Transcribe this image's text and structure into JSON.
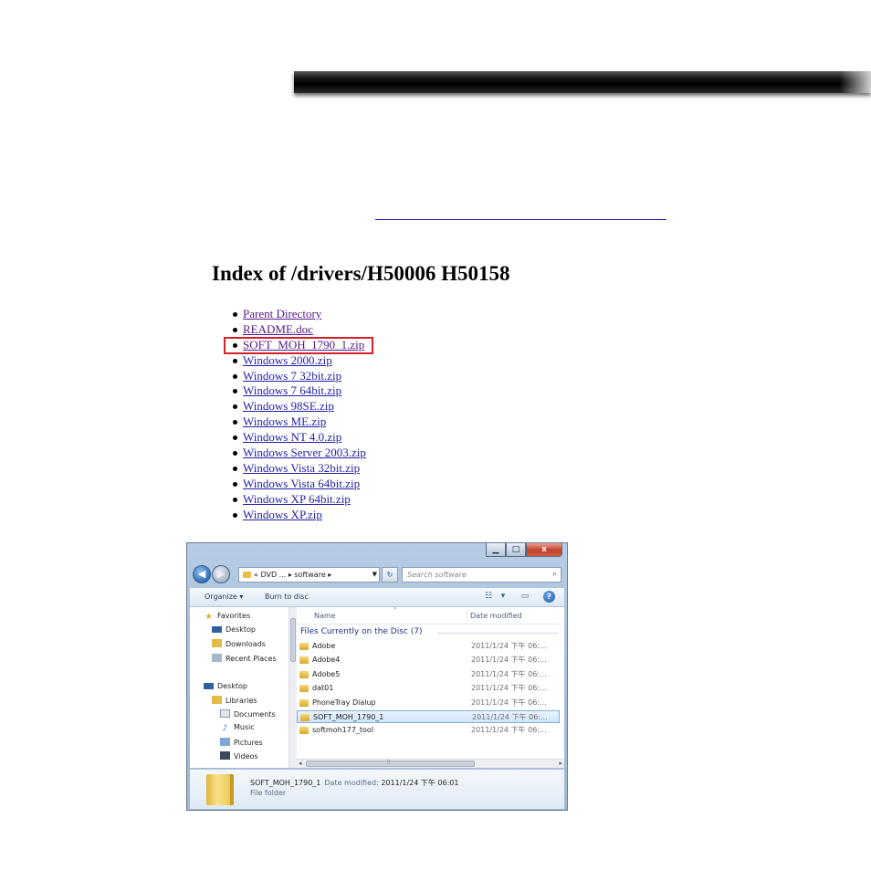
{
  "index": {
    "title": "Index of /drivers/H50006 H50158",
    "items": [
      {
        "label": "Parent Directory",
        "visited": true
      },
      {
        "label": "README.doc",
        "visited": true
      },
      {
        "label": "SOFT_MOH_1790_1.zip",
        "visited": true,
        "highlighted": true
      },
      {
        "label": "Windows 2000.zip",
        "visited": false
      },
      {
        "label": "Windows 7 32bit.zip",
        "visited": false
      },
      {
        "label": "Windows 7 64bit.zip",
        "visited": false
      },
      {
        "label": "Windows 98SE.zip",
        "visited": false
      },
      {
        "label": "Windows ME.zip",
        "visited": false
      },
      {
        "label": "Windows NT 4.0.zip",
        "visited": false
      },
      {
        "label": "Windows Server 2003.zip",
        "visited": false
      },
      {
        "label": "Windows Vista 32bit.zip",
        "visited": false
      },
      {
        "label": "Windows Vista 64bit.zip",
        "visited": false
      },
      {
        "label": "Windows XP 64bit.zip",
        "visited": false
      },
      {
        "label": "Windows XP.zip",
        "visited": false
      }
    ],
    "highlight_color": "#d0202a"
  },
  "explorer": {
    "caption": {
      "minimize": "▁",
      "maximize": "□",
      "close": "x"
    },
    "address": {
      "prefix": "«",
      "crumb1": "DVD ...",
      "sep": "▸",
      "crumb2": "software",
      "sep2": "▸"
    },
    "search_placeholder": "Search software",
    "toolbar": {
      "organize": "Organize ▾",
      "burn": "Burn to disc"
    },
    "nav": {
      "favorites": "Favorites",
      "desktop": "Desktop",
      "downloads": "Downloads",
      "recent_places": "Recent Places",
      "desktop2": "Desktop",
      "libraries": "Libraries",
      "documents": "Documents",
      "music": "Music",
      "pictures": "Pictures",
      "videos": "Videos"
    },
    "columns": {
      "name": "Name",
      "date": "Date modified"
    },
    "group_title": "Files Currently on the Disc (7)",
    "files": [
      {
        "name": "Adobe",
        "date": "2011/1/24 下午 06:..."
      },
      {
        "name": "Adobe4",
        "date": "2011/1/24 下午 06:..."
      },
      {
        "name": "Adobe5",
        "date": "2011/1/24 下午 06:..."
      },
      {
        "name": "dat01",
        "date": "2011/1/24 下午 06:..."
      },
      {
        "name": "PhoneTray Dialup",
        "date": "2011/1/24 下午 06:..."
      },
      {
        "name": "SOFT_MOH_1790_1",
        "date": "2011/1/24 下午 06:...",
        "selected": true
      },
      {
        "name": "softmoh177_tool",
        "date": "2011/1/24 下午 06:..."
      }
    ],
    "details": {
      "name": "SOFT_MOH_1790_1",
      "modified_label": "Date modified:",
      "modified_value": "2011/1/24 下午 06:01",
      "type": "File folder"
    }
  }
}
